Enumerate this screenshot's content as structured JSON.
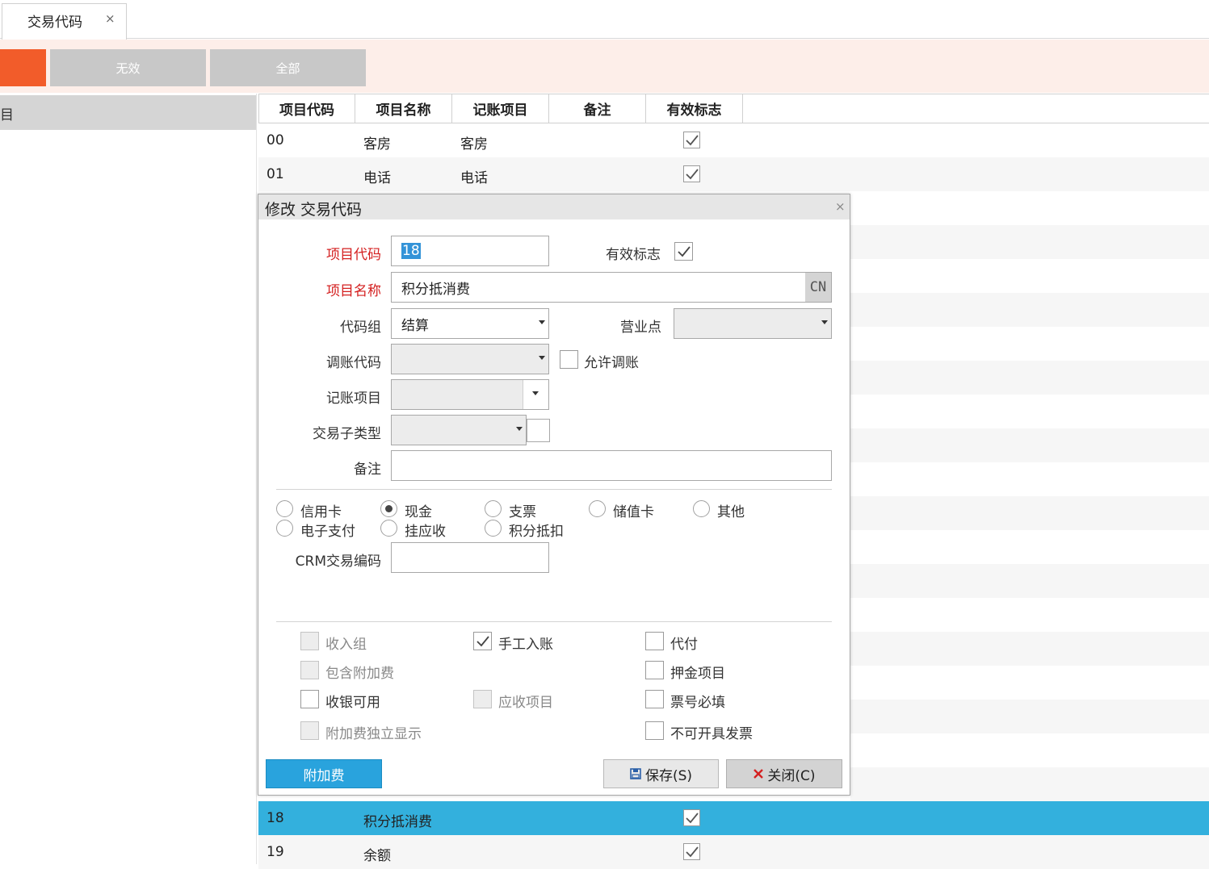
{
  "tab": {
    "label": "交易代码",
    "close": "×"
  },
  "toolbar": {
    "invalid_label": "无效",
    "all_label": "全部"
  },
  "left_panel": {
    "header": "目"
  },
  "grid": {
    "columns": [
      "项目代码",
      "项目名称",
      "记账项目",
      "备注",
      "有效标志"
    ],
    "rows": [
      {
        "code": "00",
        "name": "客房",
        "account": "客房",
        "valid": true
      },
      {
        "code": "01",
        "name": "电话",
        "account": "电话",
        "valid": true
      },
      {
        "code": "18",
        "name": "积分抵消费",
        "account": "",
        "valid": true,
        "selected": true
      },
      {
        "code": "19",
        "name": "余额",
        "account": "",
        "valid": true
      }
    ]
  },
  "dialog": {
    "title": "修改 交易代码",
    "close": "×",
    "fields": {
      "code_label": "项目代码",
      "code_value": "18",
      "valid_label": "有效标志",
      "valid_checked": true,
      "name_label": "项目名称",
      "name_value": "积分抵消费",
      "lang_badge": "CN",
      "group_label": "代码组",
      "group_value": "结算",
      "outlet_label": "营业点",
      "outlet_value": "",
      "adjust_label": "调账代码",
      "adjust_value": "",
      "allow_adjust_label": "允许调账",
      "account_label": "记账项目",
      "account_value": "",
      "subtype_label": "交易子类型",
      "subtype_value": "",
      "remark_label": "备注",
      "remark_value": "",
      "crm_label": "CRM交易编码",
      "crm_value": ""
    },
    "payment_types": [
      {
        "label": "信用卡",
        "selected": false
      },
      {
        "label": "现金",
        "selected": true
      },
      {
        "label": "支票",
        "selected": false
      },
      {
        "label": "储值卡",
        "selected": false
      },
      {
        "label": "其他",
        "selected": false
      },
      {
        "label": "电子支付",
        "selected": false
      },
      {
        "label": "挂应收",
        "selected": false
      },
      {
        "label": "积分抵扣",
        "selected": false
      }
    ],
    "options": {
      "income_group": "收入组",
      "manual_post": "手工入账",
      "agency_pay": "代付",
      "include_surcharge": "包含附加费",
      "deposit_item": "押金项目",
      "cashier_usable": "收银可用",
      "receivable_item": "应收项目",
      "ticket_required": "票号必填",
      "surcharge_separate": "附加费独立显示",
      "no_invoice": "不可开具发票"
    },
    "buttons": {
      "surcharge": "附加费",
      "save": "保存(S)",
      "close": "关闭(C)"
    }
  },
  "colors": {
    "accent": "#f25c2a",
    "selection": "#33b0dd",
    "required": "#d42020"
  }
}
